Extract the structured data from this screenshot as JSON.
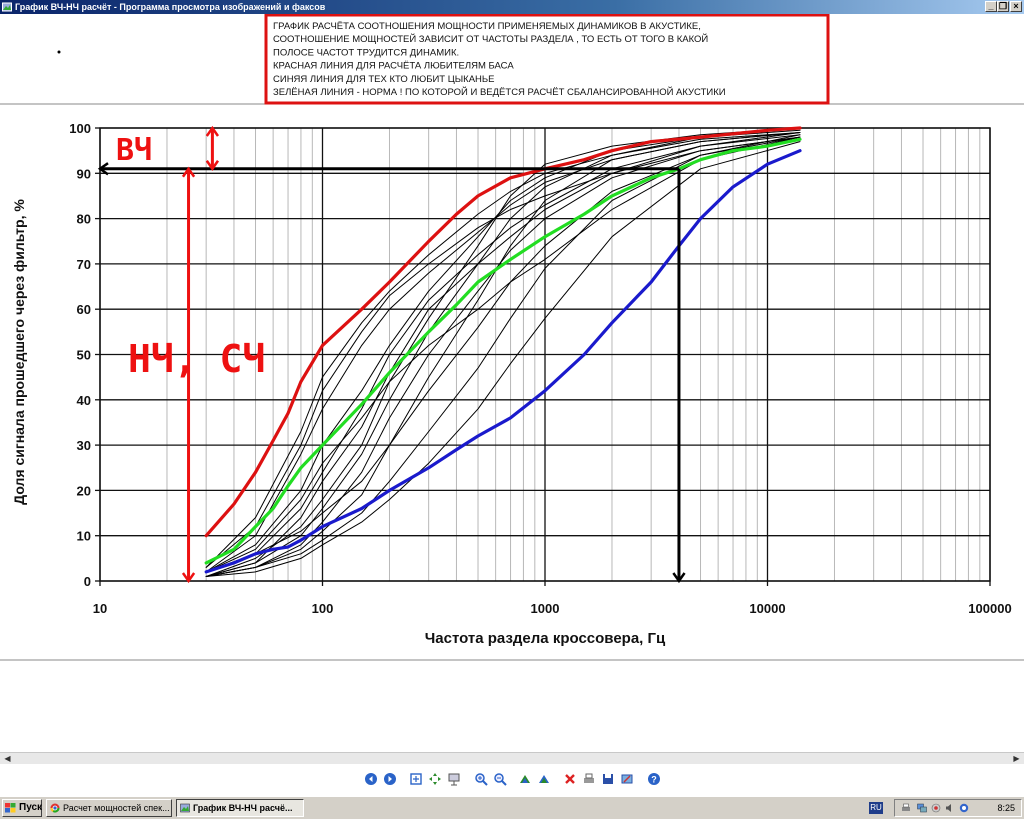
{
  "window": {
    "title": "График ВЧ-НЧ расчёт - Программа просмотра изображений и факсов",
    "minimize": "_",
    "restore": "❐",
    "close": "×"
  },
  "note": {
    "lines": [
      "ГРАФИК РАСЧЁТА СООТНОШЕНИЯ МОЩНОСТИ ПРИМЕНЯЕМЫХ ДИНАМИКОВ В АКУСТИКЕ,",
      "СООТНОШЕНИЕ МОЩНОСТЕЙ ЗАВИСИТ ОТ ЧАСТОТЫ РАЗДЕЛА , ТО ЕСТЬ ОТ ТОГО В КАКОЙ",
      "ПОЛОСЕ ЧАСТОТ ТРУДИТСЯ ДИНАМИК.",
      "КРАСНАЯ ЛИНИЯ ДЛЯ РАСЧЁТА ЛЮБИТЕЛЯМ БАСА",
      "СИНЯЯ ЛИНИЯ ДЛЯ ТЕХ КТО ЛЮБИТ ЦЫКАНЬЕ",
      "ЗЕЛЁНАЯ ЛИНИЯ - НОРМА ! ПО КОТОРОЙ И ВЕДЁТСЯ РАСЧЁТ СБАЛАНСИРОВАННОЙ АКУСТИКИ"
    ],
    "border_color": "#dd1111"
  },
  "annotations": {
    "hf_label": "ВЧ",
    "lf_label": "НЧ, СЧ",
    "color": "#ee1111"
  },
  "chart_data": {
    "type": "line",
    "xlabel": "Частота раздела кроссовера, Гц",
    "ylabel": "Доля сигнала прошедшего через фильтр, %",
    "x_scale": "log",
    "xlim": [
      10,
      100000
    ],
    "ylim": [
      0,
      100
    ],
    "x_ticks": [
      "10",
      "100",
      "1000",
      "10000",
      "100000"
    ],
    "y_ticks": [
      "0",
      "10",
      "20",
      "30",
      "40",
      "50",
      "60",
      "70",
      "80",
      "90",
      "100"
    ],
    "grid": true,
    "series": [
      {
        "color": "#dd1111",
        "points": [
          [
            30,
            10
          ],
          [
            40,
            17
          ],
          [
            50,
            24
          ],
          [
            60,
            31
          ],
          [
            70,
            37
          ],
          [
            80,
            44
          ],
          [
            100,
            52
          ],
          [
            150,
            60
          ],
          [
            200,
            66
          ],
          [
            300,
            75
          ],
          [
            400,
            81
          ],
          [
            500,
            85
          ],
          [
            700,
            89
          ],
          [
            1000,
            91
          ],
          [
            1500,
            93
          ],
          [
            2000,
            95
          ],
          [
            3000,
            97
          ],
          [
            5000,
            98
          ],
          [
            10000,
            99.5
          ],
          [
            14000,
            100
          ]
        ]
      },
      {
        "color": "#22dd22",
        "points": [
          [
            30,
            4
          ],
          [
            40,
            7
          ],
          [
            50,
            12
          ],
          [
            60,
            16
          ],
          [
            70,
            21
          ],
          [
            80,
            25
          ],
          [
            100,
            30
          ],
          [
            150,
            39
          ],
          [
            200,
            46
          ],
          [
            300,
            55
          ],
          [
            400,
            61
          ],
          [
            500,
            66
          ],
          [
            700,
            71
          ],
          [
            1000,
            76
          ],
          [
            1500,
            81
          ],
          [
            2000,
            85
          ],
          [
            3000,
            89
          ],
          [
            4000,
            91
          ],
          [
            5000,
            93
          ],
          [
            7000,
            95
          ],
          [
            10000,
            96
          ],
          [
            14000,
            97.5
          ]
        ]
      },
      {
        "color": "#1a1acc",
        "points": [
          [
            30,
            2
          ],
          [
            40,
            4
          ],
          [
            50,
            6
          ],
          [
            60,
            7
          ],
          [
            70,
            7.5
          ],
          [
            80,
            9
          ],
          [
            100,
            12
          ],
          [
            150,
            16
          ],
          [
            200,
            20
          ],
          [
            300,
            25
          ],
          [
            400,
            29
          ],
          [
            500,
            32
          ],
          [
            700,
            36
          ],
          [
            1000,
            42
          ],
          [
            1500,
            50
          ],
          [
            2000,
            57
          ],
          [
            3000,
            66
          ],
          [
            4000,
            74
          ],
          [
            5000,
            80
          ],
          [
            7000,
            87
          ],
          [
            10000,
            92
          ],
          [
            14000,
            95
          ]
        ]
      },
      {
        "color": "#000000",
        "points": [
          [
            30,
            3
          ],
          [
            50,
            14
          ],
          [
            80,
            33
          ],
          [
            100,
            45
          ],
          [
            150,
            57
          ],
          [
            200,
            64
          ],
          [
            300,
            72
          ],
          [
            500,
            81
          ],
          [
            700,
            86
          ],
          [
            1000,
            90
          ],
          [
            2000,
            94
          ],
          [
            5000,
            98
          ],
          [
            14000,
            100
          ]
        ]
      },
      {
        "color": "#000000",
        "points": [
          [
            30,
            2
          ],
          [
            50,
            8
          ],
          [
            80,
            20
          ],
          [
            100,
            30
          ],
          [
            150,
            42
          ],
          [
            200,
            52
          ],
          [
            300,
            64
          ],
          [
            500,
            76
          ],
          [
            700,
            84
          ],
          [
            1000,
            89
          ],
          [
            2000,
            95
          ],
          [
            5000,
            98
          ],
          [
            14000,
            99.5
          ]
        ]
      },
      {
        "color": "#000000",
        "points": [
          [
            30,
            1
          ],
          [
            50,
            4
          ],
          [
            80,
            10
          ],
          [
            100,
            16
          ],
          [
            150,
            28
          ],
          [
            200,
            40
          ],
          [
            300,
            55
          ],
          [
            500,
            70
          ],
          [
            700,
            80
          ],
          [
            1000,
            87
          ],
          [
            2000,
            94
          ],
          [
            5000,
            97.5
          ],
          [
            14000,
            99
          ]
        ]
      },
      {
        "color": "#000000",
        "points": [
          [
            30,
            2
          ],
          [
            50,
            6
          ],
          [
            80,
            16
          ],
          [
            100,
            24
          ],
          [
            150,
            38
          ],
          [
            200,
            50
          ],
          [
            300,
            62
          ],
          [
            500,
            72
          ],
          [
            700,
            78
          ],
          [
            1000,
            83
          ],
          [
            2000,
            91
          ],
          [
            5000,
            96
          ],
          [
            14000,
            99
          ]
        ]
      },
      {
        "color": "#000000",
        "points": [
          [
            30,
            1
          ],
          [
            50,
            3
          ],
          [
            80,
            6
          ],
          [
            100,
            9
          ],
          [
            150,
            15
          ],
          [
            200,
            22
          ],
          [
            300,
            33
          ],
          [
            500,
            47
          ],
          [
            700,
            58
          ],
          [
            1000,
            69
          ],
          [
            2000,
            84
          ],
          [
            5000,
            94
          ],
          [
            14000,
            98.5
          ]
        ]
      },
      {
        "color": "#000000",
        "points": [
          [
            30,
            1
          ],
          [
            50,
            2
          ],
          [
            80,
            5
          ],
          [
            100,
            8
          ],
          [
            150,
            13
          ],
          [
            200,
            18
          ],
          [
            300,
            26
          ],
          [
            500,
            38
          ],
          [
            700,
            48
          ],
          [
            1000,
            58
          ],
          [
            2000,
            76
          ],
          [
            5000,
            91
          ],
          [
            14000,
            97
          ]
        ]
      },
      {
        "color": "#000000",
        "points": [
          [
            30,
            1
          ],
          [
            50,
            3
          ],
          [
            80,
            8
          ],
          [
            100,
            13
          ],
          [
            150,
            24
          ],
          [
            200,
            36
          ],
          [
            300,
            50
          ],
          [
            500,
            64
          ],
          [
            700,
            73
          ],
          [
            1000,
            80
          ],
          [
            2000,
            89
          ],
          [
            5000,
            95
          ],
          [
            14000,
            98
          ]
        ]
      },
      {
        "color": "#000000",
        "points": [
          [
            30,
            2
          ],
          [
            50,
            10
          ],
          [
            80,
            28
          ],
          [
            100,
            38
          ],
          [
            150,
            52
          ],
          [
            200,
            60
          ],
          [
            300,
            68
          ],
          [
            500,
            77
          ],
          [
            700,
            83
          ],
          [
            1000,
            88
          ],
          [
            2000,
            93
          ],
          [
            5000,
            97
          ],
          [
            14000,
            99
          ]
        ]
      },
      {
        "color": "#000000",
        "points": [
          [
            30,
            1
          ],
          [
            50,
            5
          ],
          [
            80,
            12
          ],
          [
            100,
            18
          ],
          [
            150,
            30
          ],
          [
            200,
            44
          ],
          [
            300,
            58
          ],
          [
            500,
            74
          ],
          [
            700,
            85
          ],
          [
            1000,
            92
          ],
          [
            2000,
            96
          ],
          [
            5000,
            98.5
          ],
          [
            14000,
            100
          ]
        ]
      },
      {
        "color": "#000000",
        "points": [
          [
            30,
            2
          ],
          [
            50,
            7
          ],
          [
            80,
            18
          ],
          [
            100,
            26
          ],
          [
            150,
            36
          ],
          [
            200,
            44
          ],
          [
            300,
            52
          ],
          [
            500,
            60
          ],
          [
            700,
            66
          ],
          [
            1000,
            71
          ],
          [
            2000,
            82
          ],
          [
            5000,
            93
          ],
          [
            14000,
            98
          ]
        ]
      },
      {
        "color": "#000000",
        "points": [
          [
            30,
            1
          ],
          [
            50,
            4
          ],
          [
            80,
            14
          ],
          [
            100,
            22
          ],
          [
            150,
            34
          ],
          [
            200,
            46
          ],
          [
            300,
            60
          ],
          [
            500,
            70
          ],
          [
            700,
            76
          ],
          [
            1000,
            82
          ],
          [
            2000,
            90
          ],
          [
            5000,
            96
          ],
          [
            14000,
            98.5
          ]
        ]
      },
      {
        "color": "#000000",
        "points": [
          [
            30,
            3
          ],
          [
            50,
            12
          ],
          [
            80,
            30
          ],
          [
            100,
            42
          ],
          [
            150,
            55
          ],
          [
            200,
            63
          ],
          [
            300,
            70
          ],
          [
            500,
            78
          ],
          [
            700,
            82
          ],
          [
            1000,
            85
          ],
          [
            2000,
            90
          ],
          [
            5000,
            95
          ],
          [
            14000,
            98
          ]
        ]
      },
      {
        "color": "#000000",
        "points": [
          [
            30,
            1
          ],
          [
            50,
            3
          ],
          [
            80,
            7
          ],
          [
            100,
            11
          ],
          [
            150,
            19
          ],
          [
            200,
            30
          ],
          [
            300,
            45
          ],
          [
            500,
            62
          ],
          [
            700,
            74
          ],
          [
            1000,
            84
          ],
          [
            2000,
            93
          ],
          [
            5000,
            97
          ],
          [
            14000,
            99
          ]
        ]
      },
      {
        "color": "#000000",
        "points": [
          [
            30,
            2
          ],
          [
            50,
            6
          ],
          [
            80,
            11
          ],
          [
            100,
            15
          ],
          [
            150,
            22
          ],
          [
            200,
            30
          ],
          [
            300,
            42
          ],
          [
            500,
            56
          ],
          [
            700,
            66
          ],
          [
            1000,
            74
          ],
          [
            2000,
            86
          ],
          [
            5000,
            94
          ],
          [
            14000,
            98
          ]
        ]
      }
    ],
    "guides": [
      {
        "color": "#000000",
        "kind": "horizontal",
        "y": 91,
        "x_from": 10,
        "x_to": 4000
      },
      {
        "color": "#000000",
        "kind": "vertical",
        "x": 4000,
        "y_from": 91,
        "y_to": 0
      },
      {
        "color": "#ee1111",
        "kind": "vertical",
        "x": 25,
        "y_from": 91,
        "y_to": 0
      },
      {
        "color": "#ee1111",
        "kind": "vertical",
        "x": 32,
        "y_from": 100,
        "y_to": 91
      }
    ]
  },
  "toolbar_icons": [
    "prev-image-icon",
    "next-image-icon",
    "best-fit-icon",
    "actual-size-icon",
    "slideshow-icon",
    "zoom-in-icon",
    "zoom-out-icon",
    "rotate-clockwise-icon",
    "rotate-counterclockwise-icon",
    "delete-icon",
    "print-icon",
    "save-icon",
    "edit-icon",
    "help-icon"
  ],
  "taskbar": {
    "start": "Пуск",
    "tasks": [
      {
        "label": "Расчет мощностей спек..."
      },
      {
        "label": "График ВЧ-НЧ расчё..."
      }
    ],
    "lang": "RU",
    "clock": "8:25"
  }
}
